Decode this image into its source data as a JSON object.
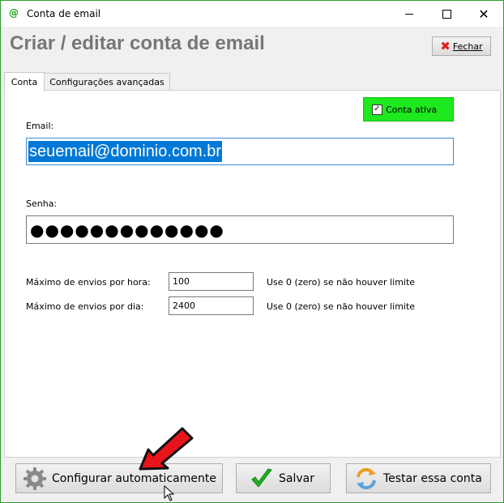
{
  "window": {
    "title": "Conta de email",
    "app_icon": "@"
  },
  "header": {
    "title": "Criar / editar conta de email",
    "close_label": "Fechar"
  },
  "tabs": [
    {
      "label": "Conta",
      "active": true
    },
    {
      "label": "Configurações avançadas",
      "active": false
    }
  ],
  "account_active": {
    "label": "Conta ativa",
    "checked": true,
    "color": "#1ee81e"
  },
  "fields": {
    "email_label": "Email:",
    "email_value": "seuemail@dominio.com.br",
    "senha_label": "Senha:",
    "senha_value": "●●●●●●●●●●●●●",
    "max_hora_label": "Máximo de envios por hora:",
    "max_hora_value": "100",
    "max_hora_hint": "Use 0 (zero) se não houver limite",
    "max_dia_label": "Máximo de envios por dia:",
    "max_dia_value": "2400",
    "max_dia_hint": "Use 0 (zero) se não houver limite"
  },
  "buttons": {
    "auto_config": "Configurar automaticamente",
    "save": "Salvar",
    "test": "Testar essa conta"
  },
  "icons": {
    "gear": "gear-icon",
    "check": "checkmark-icon",
    "refresh": "refresh-icon",
    "close": "close-icon",
    "arrow": "red-arrow-icon"
  }
}
